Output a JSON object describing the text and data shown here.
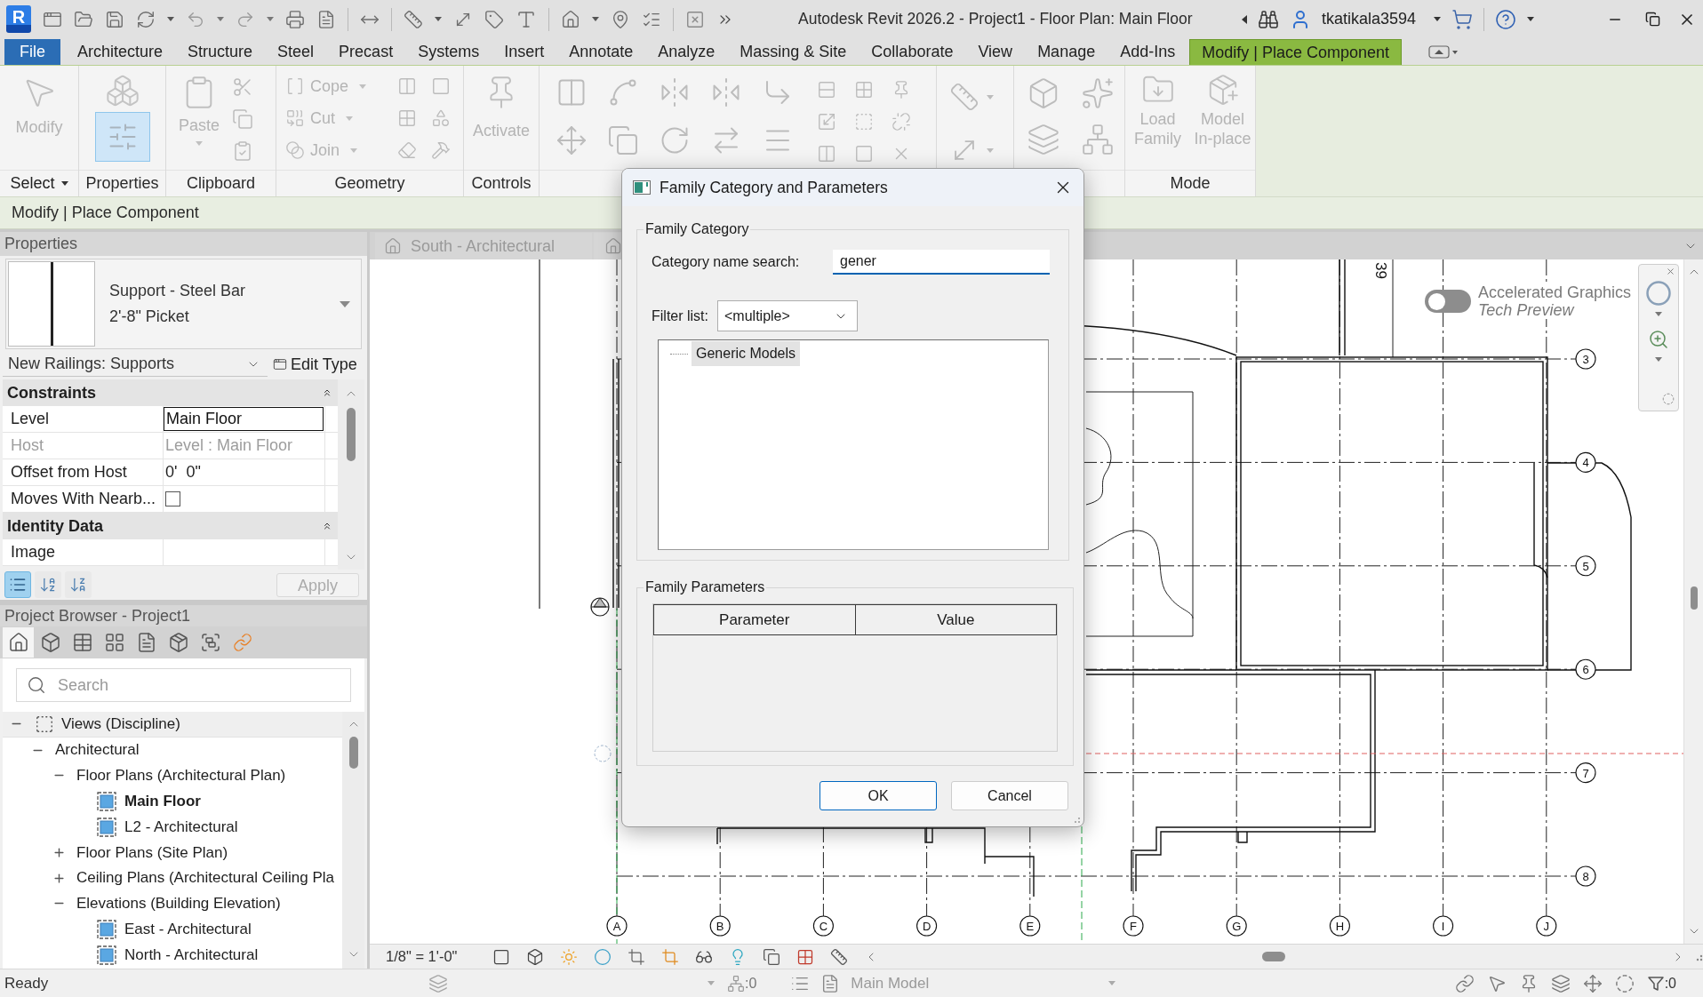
{
  "title_bar": {
    "logo": "R",
    "title": "Autodesk Revit 2026.2 - Project1 - Floor Plan: Main Floor",
    "user": "tkatikala3594"
  },
  "menu_tabs": [
    {
      "label": "File",
      "kind": "file",
      "selected": false
    },
    {
      "label": "Architecture",
      "kind": "tab",
      "selected": false
    },
    {
      "label": "Structure",
      "kind": "tab",
      "selected": false
    },
    {
      "label": "Steel",
      "kind": "tab",
      "selected": false
    },
    {
      "label": "Precast",
      "kind": "tab",
      "selected": false
    },
    {
      "label": "Systems",
      "kind": "tab",
      "selected": false
    },
    {
      "label": "Insert",
      "kind": "tab",
      "selected": false
    },
    {
      "label": "Annotate",
      "kind": "tab",
      "selected": false
    },
    {
      "label": "Analyze",
      "kind": "tab",
      "selected": false
    },
    {
      "label": "Massing & Site",
      "kind": "tab",
      "selected": false
    },
    {
      "label": "Collaborate",
      "kind": "tab",
      "selected": false
    },
    {
      "label": "View",
      "kind": "tab",
      "selected": false
    },
    {
      "label": "Manage",
      "kind": "tab",
      "selected": false
    },
    {
      "label": "Add-Ins",
      "kind": "tab",
      "selected": false
    },
    {
      "label": "Modify | Place Component",
      "kind": "context",
      "selected": true
    }
  ],
  "ribbon": {
    "panels": [
      {
        "kind": "select",
        "label": "Select",
        "tools": [
          {
            "label": "Modify",
            "disabled": true
          }
        ]
      },
      {
        "kind": "properties",
        "label": "Properties",
        "pressed": true
      },
      {
        "kind": "clipboard",
        "label": "Clipboard",
        "tools": [
          {
            "label": "Paste",
            "disabled": true
          }
        ]
      },
      {
        "kind": "geometry",
        "label": "Geometry",
        "tools": [
          {
            "label": "Cope",
            "disabled": true
          },
          {
            "label": "Cut",
            "disabled": true
          },
          {
            "label": "Join",
            "disabled": true
          }
        ]
      },
      {
        "kind": "controls",
        "label": "Controls",
        "tools": [
          {
            "label": "Activate",
            "disabled": true
          }
        ]
      },
      {
        "kind": "mode",
        "label": "Mode",
        "tools": [
          {
            "label": "Load Family",
            "disabled": true
          },
          {
            "label": "Model In-place",
            "disabled": true
          }
        ]
      }
    ]
  },
  "options_bar": {
    "label": "Modify | Place Component"
  },
  "properties": {
    "title": "Properties",
    "type_family": "Support - Steel Bar",
    "type_size": "2'-8\" Picket",
    "instance_filter": "New Railings: Supports",
    "edit_type": "Edit Type",
    "groups": [
      {
        "label": "Constraints",
        "expanded": true,
        "rows": [
          {
            "name": "Level",
            "kind": "field",
            "value": "Main Floor",
            "disabled": false
          },
          {
            "name": "Host",
            "kind": "text",
            "value": "Level : Main Floor",
            "disabled": true
          },
          {
            "name": "Offset from Host",
            "kind": "text",
            "value": "0'  0\"",
            "disabled": false
          },
          {
            "name": "Moves With Nearb...",
            "kind": "checkbox",
            "checked": false,
            "disabled": false
          }
        ]
      },
      {
        "label": "Identity Data",
        "expanded": true,
        "rows": [
          {
            "name": "Image",
            "kind": "text",
            "disabled": false
          }
        ]
      }
    ],
    "sort_buttons": [
      {
        "kind": "categorized",
        "selected": true
      },
      {
        "kind": "ascending",
        "selected": false
      },
      {
        "kind": "descending",
        "selected": false
      }
    ],
    "apply": {
      "label": "Apply",
      "disabled": true
    }
  },
  "project_browser": {
    "title": "Project Browser - Project1",
    "toolbar": [
      {
        "kind": "views",
        "selected": true
      },
      {
        "kind": "view3d",
        "selected": false
      },
      {
        "kind": "schedules",
        "selected": false
      },
      {
        "kind": "tables",
        "selected": false
      },
      {
        "kind": "sheets",
        "selected": false
      },
      {
        "kind": "families",
        "selected": false
      },
      {
        "kind": "groups",
        "selected": false
      },
      {
        "kind": "links",
        "selected": false
      }
    ],
    "search": {
      "placeholder": "Search"
    },
    "tree": [
      {
        "label": "Views (Discipline)",
        "kind": "root",
        "expanded": true,
        "children": [
          {
            "label": "Architectural",
            "kind": "group",
            "expanded": true,
            "children": [
              {
                "label": "Floor Plans (Architectural Plan)",
                "kind": "group",
                "expanded": true,
                "children": [
                  {
                    "label": "Main Floor",
                    "kind": "view",
                    "active": true
                  },
                  {
                    "label": "L2 - Architectural",
                    "kind": "view",
                    "active": false
                  }
                ]
              },
              {
                "label": "Floor Plans (Site Plan)",
                "kind": "group",
                "expanded": false
              },
              {
                "label": "Ceiling Plans (Architectural Ceiling Pla",
                "kind": "group",
                "expanded": false
              },
              {
                "label": "Elevations (Building Elevation)",
                "kind": "group",
                "expanded": true,
                "children": [
                  {
                    "label": "East - Architectural",
                    "kind": "view",
                    "active": false
                  },
                  {
                    "label": "North - Architectural",
                    "kind": "view",
                    "active": false
                  }
                ]
              }
            ]
          }
        ]
      }
    ]
  },
  "view_tabs": [
    {
      "label": "South - Architectural",
      "selected": false
    }
  ],
  "canvas": {
    "grid_columns": [
      "A",
      "B",
      "C",
      "D",
      "E",
      "F",
      "G",
      "H",
      "I",
      "J"
    ],
    "grid_rows": [
      "3",
      "4",
      "5",
      "6",
      "7",
      "8"
    ],
    "tag_text": "39",
    "graphics_toggle": {
      "label": "Accelerated Graphics",
      "sublabel": "Tech Preview",
      "on": false
    }
  },
  "view_control_bar": {
    "scale": "1/8\" = 1'-0\""
  },
  "status_bar": {
    "message": "Ready",
    "design_options_count": ":0",
    "model": {
      "label": "Main Model",
      "disabled": true
    },
    "filter_count": ":0"
  },
  "dialog": {
    "title": "Family Category and Parameters",
    "category_group": "Family Category",
    "search_label": "Category name search:",
    "search_value": "gener",
    "filter_label": "Filter list:",
    "filter_value": "<multiple>",
    "categories": [
      {
        "label": "Generic Models",
        "selected": true
      }
    ],
    "parameters_group": "Family Parameters",
    "parameter_columns": [
      "Parameter",
      "Value"
    ],
    "buttons": [
      {
        "label": "OK",
        "kind": "default"
      },
      {
        "label": "Cancel",
        "kind": "normal"
      }
    ]
  }
}
